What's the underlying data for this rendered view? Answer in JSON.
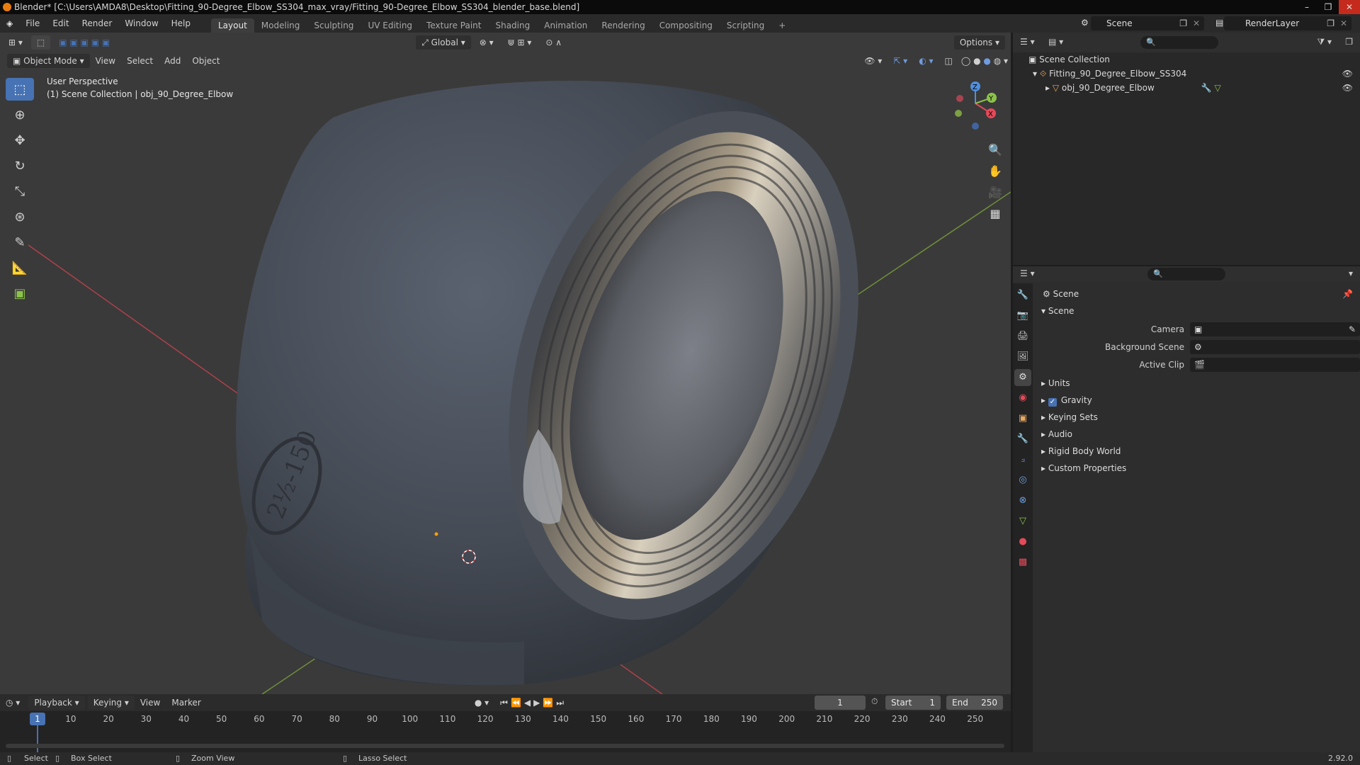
{
  "window": {
    "title": "Blender* [C:\\Users\\AMDA8\\Desktop\\Fitting_90-Degree_Elbow_SS304_max_vray/Fitting_90-Degree_Elbow_SS304_blender_base.blend]",
    "controls": [
      "–",
      "❐",
      "✕"
    ]
  },
  "menu": [
    "File",
    "Edit",
    "Render",
    "Window",
    "Help"
  ],
  "workspaces": [
    "Layout",
    "Modeling",
    "Sculpting",
    "UV Editing",
    "Texture Paint",
    "Shading",
    "Animation",
    "Rendering",
    "Compositing",
    "Scripting",
    "+"
  ],
  "active_workspace": "Layout",
  "scene_name": "Scene",
  "render_layer": "RenderLayer",
  "viewport": {
    "transform_orientation": "Global",
    "options_label": "Options",
    "mode": "Object Mode",
    "header_menu": [
      "View",
      "Select",
      "Add",
      "Object"
    ],
    "info_line1": "User Perspective",
    "info_line2": "(1) Scene Collection | obj_90_Degree_Elbow",
    "gizmo_axes": [
      "X",
      "Y",
      "Z"
    ],
    "emboss_text": "2½-150"
  },
  "timeline": {
    "menus": [
      "Playback",
      "Keying",
      "View",
      "Marker"
    ],
    "current_frame": "1",
    "start_label": "Start",
    "start": "1",
    "end_label": "End",
    "end": "250",
    "ticks": [
      "1",
      "10",
      "20",
      "30",
      "40",
      "50",
      "60",
      "70",
      "80",
      "90",
      "100",
      "110",
      "120",
      "130",
      "140",
      "150",
      "160",
      "170",
      "180",
      "190",
      "200",
      "210",
      "220",
      "230",
      "240",
      "250"
    ]
  },
  "status": {
    "select": "Select",
    "box_select": "Box Select",
    "zoom_view": "Zoom View",
    "lasso_select": "Lasso Select",
    "version": "2.92.0"
  },
  "outliner": {
    "root": "Scene Collection",
    "collection": "Fitting_90_Degree_Elbow_SS304",
    "object": "obj_90_Degree_Elbow"
  },
  "properties": {
    "context": "Scene",
    "panel": "Scene",
    "fields": [
      {
        "label": "Camera"
      },
      {
        "label": "Background Scene"
      },
      {
        "label": "Active Clip"
      }
    ],
    "sections": [
      "Units",
      "Gravity",
      "Keying Sets",
      "Audio",
      "Rigid Body World",
      "Custom Properties"
    ],
    "gravity_checked": true
  },
  "colors": {
    "accent": "#4772b3",
    "x_axis": "#e44a5a",
    "y_axis": "#8bc34a",
    "z_axis": "#4f8fe0"
  }
}
